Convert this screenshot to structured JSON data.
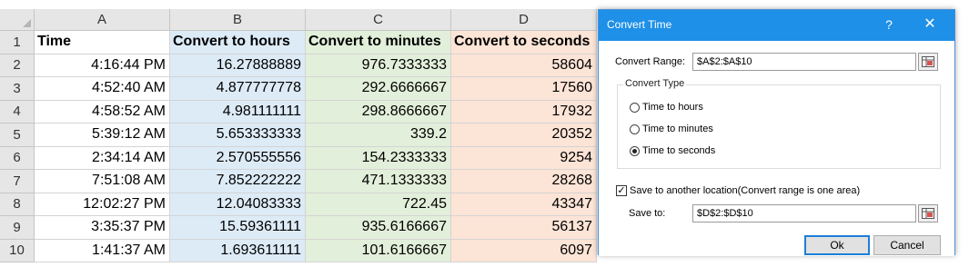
{
  "spreadsheet": {
    "columns": [
      "A",
      "B",
      "C",
      "D"
    ],
    "rows": [
      {
        "num": "1",
        "a": "Time",
        "b": "Convert to hours",
        "c": "Convert to minutes",
        "d": "Convert to seconds"
      },
      {
        "num": "2",
        "a": "4:16:44 PM",
        "b": "16.27888889",
        "c": "976.7333333",
        "d": "58604"
      },
      {
        "num": "3",
        "a": "4:52:40 AM",
        "b": "4.877777778",
        "c": "292.6666667",
        "d": "17560"
      },
      {
        "num": "4",
        "a": "4:58:52 AM",
        "b": "4.981111111",
        "c": "298.8666667",
        "d": "17932"
      },
      {
        "num": "5",
        "a": "5:39:12 AM",
        "b": "5.653333333",
        "c": "339.2",
        "d": "20352"
      },
      {
        "num": "6",
        "a": "2:34:14 AM",
        "b": "2.570555556",
        "c": "154.2333333",
        "d": "9254"
      },
      {
        "num": "7",
        "a": "7:51:08 AM",
        "b": "7.852222222",
        "c": "471.1333333",
        "d": "28268"
      },
      {
        "num": "8",
        "a": "12:02:27 PM",
        "b": "12.04083333",
        "c": "722.45",
        "d": "43347"
      },
      {
        "num": "9",
        "a": "3:35:37 PM",
        "b": "15.59361111",
        "c": "935.6166667",
        "d": "56137"
      },
      {
        "num": "10",
        "a": "1:41:37 AM",
        "b": "1.693611111",
        "c": "101.6166667",
        "d": "6097"
      }
    ],
    "colors": {
      "hours": "#ddebf7",
      "minutes": "#e2efda",
      "seconds": "#fce4d6"
    }
  },
  "dialog": {
    "title": "Convert Time",
    "help": "?",
    "close": "✕",
    "convert_range_label": "Convert Range:",
    "convert_range_value": "$A$2:$A$10",
    "convert_type_title": "Convert Type",
    "options": [
      "Time to hours",
      "Time to minutes",
      "Time to seconds"
    ],
    "selected_option": "Time to seconds",
    "save_check_label": "Save to another location(Convert range is one area)",
    "save_checked": true,
    "save_to_label": "Save to:",
    "save_to_value": "$D$2:$D$10",
    "ok_label": "Ok",
    "cancel_label": "Cancel",
    "accent": "#1e90e8"
  }
}
